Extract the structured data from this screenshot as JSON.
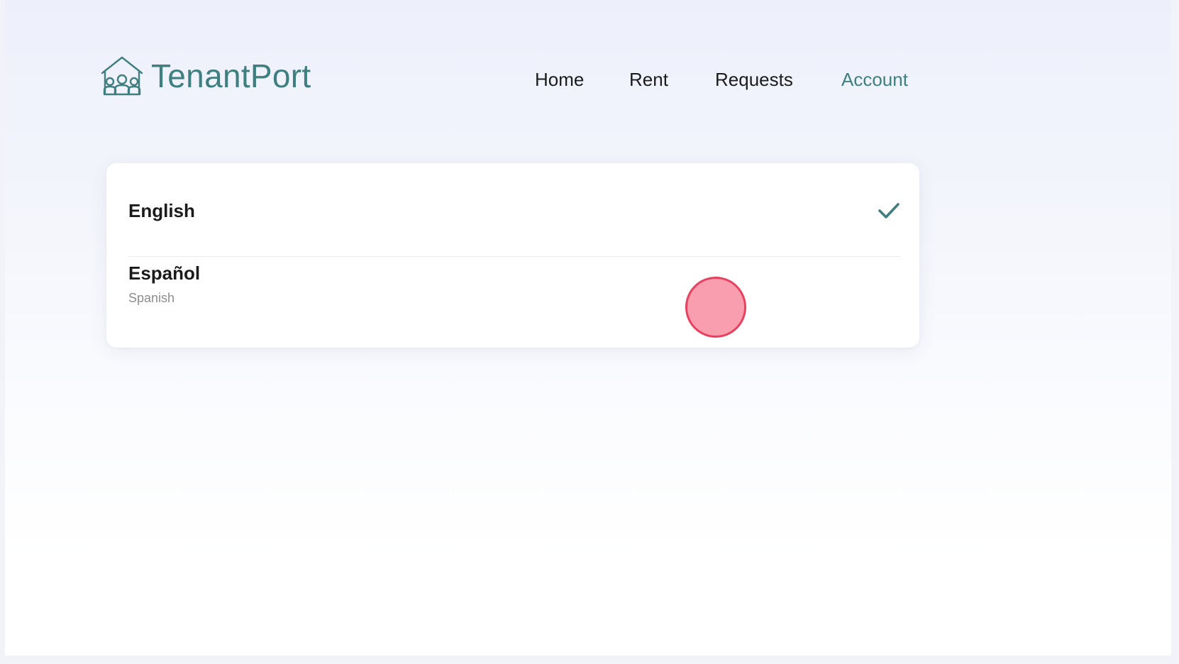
{
  "app": {
    "brand": "TenantPort",
    "logo_icon": "house-people-icon",
    "brand_color": "#3f7f80"
  },
  "nav": {
    "items": [
      {
        "label": "Home",
        "active": false
      },
      {
        "label": "Rent",
        "active": false
      },
      {
        "label": "Requests",
        "active": false
      },
      {
        "label": "Account",
        "active": true
      }
    ]
  },
  "languages": {
    "options": [
      {
        "label": "English",
        "subtitle": "",
        "selected": true,
        "icon": "checkmark-icon"
      },
      {
        "label": "Español",
        "subtitle": "Spanish",
        "selected": false
      }
    ]
  },
  "colors": {
    "accent": "#3f7f80",
    "text": "#1b1b1b",
    "muted": "#8e8e8e",
    "touch_indicator": "#f891a3"
  }
}
